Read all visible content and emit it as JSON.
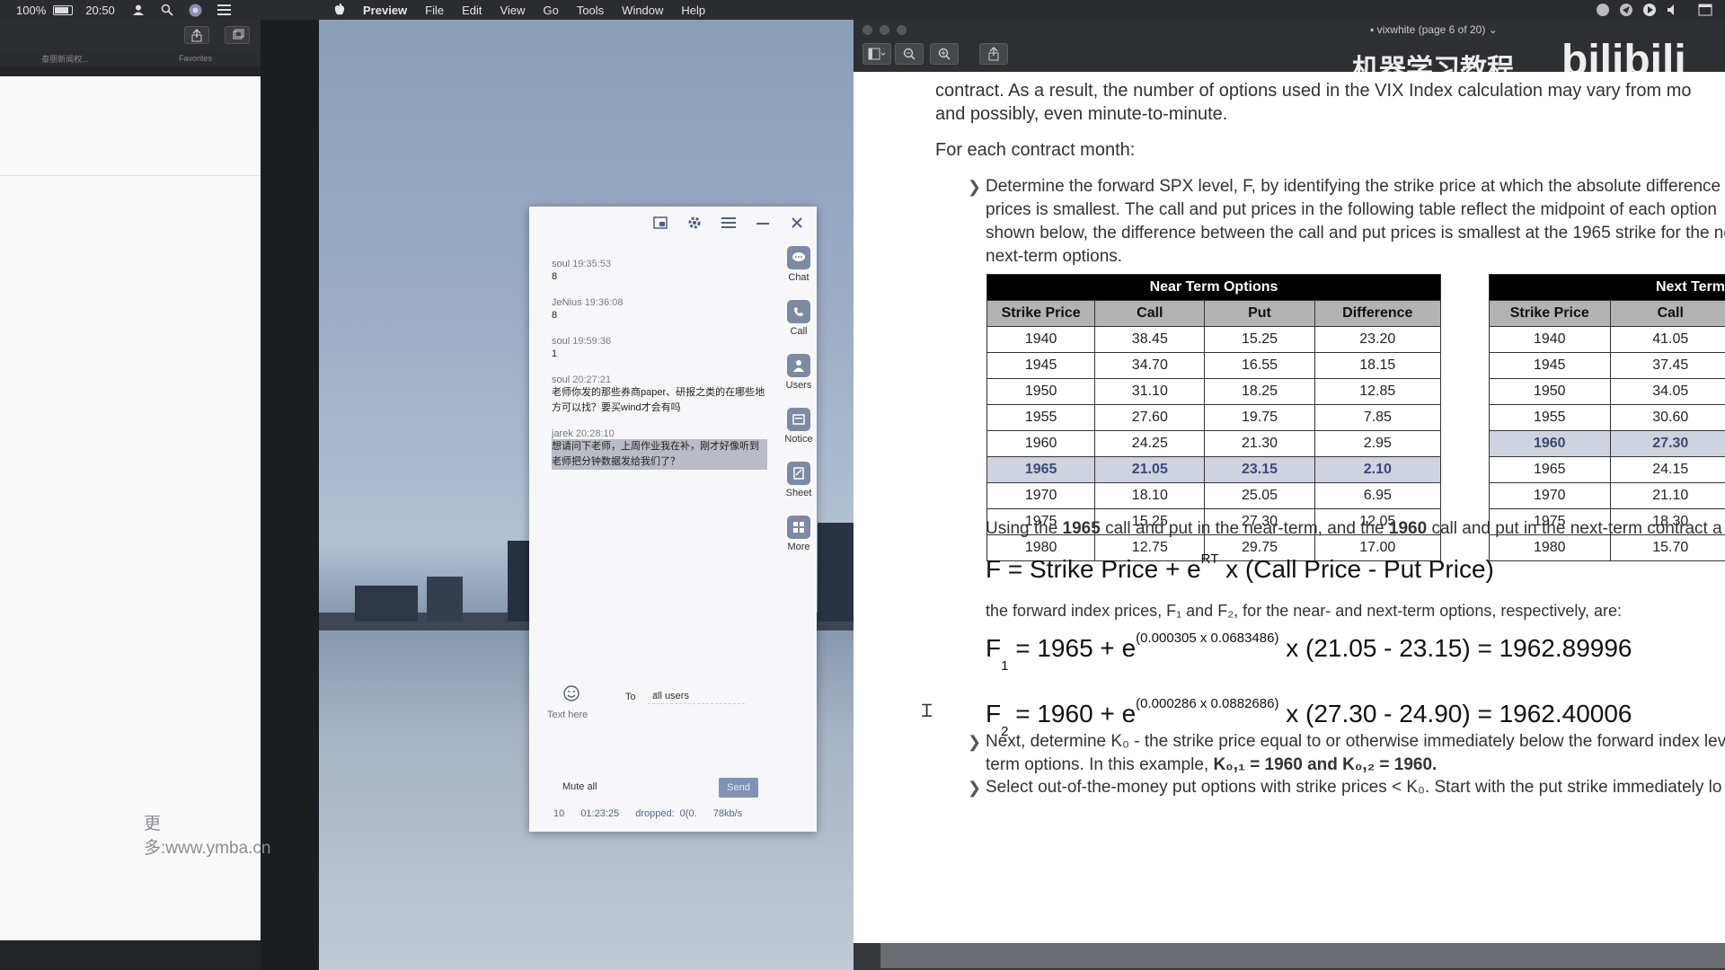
{
  "menubar": {
    "battery_percent": "100%",
    "clock": "20:50",
    "apple": "",
    "app_name": "Preview",
    "menus": [
      "File",
      "Edit",
      "View",
      "Go",
      "Tools",
      "Window",
      "Help"
    ]
  },
  "left_panel": {
    "tab_left": "泰朋新闻权...",
    "tab_right": "Favorites",
    "watermark": "更多:www.ymba.cn"
  },
  "chat": {
    "messages": [
      {
        "user": "soul",
        "time": "19:35:53",
        "text": "8",
        "selected": false
      },
      {
        "user": "JeNius",
        "time": "19:36:08",
        "text": "8",
        "selected": false
      },
      {
        "user": "soul",
        "time": "19:59:36",
        "text": "1",
        "selected": false
      },
      {
        "user": "soul",
        "time": "20:27:21",
        "text": "老师你发的那些券商paper、研报之类的在哪些地方可以找？要买wind才会有吗",
        "selected": false
      },
      {
        "user": "jarek",
        "time": "20:28:10",
        "text": "想请问下老师，上周作业我在补，刚才好像听到老师把分钟数据发给我们了？",
        "selected": true
      }
    ],
    "rail": [
      {
        "label": "Chat",
        "icon": "chat-icon"
      },
      {
        "label": "Call",
        "icon": "call-icon"
      },
      {
        "label": "Users",
        "icon": "users-icon"
      },
      {
        "label": "Notice",
        "icon": "notice-icon"
      },
      {
        "label": "Sheet",
        "icon": "sheet-icon"
      },
      {
        "label": "More",
        "icon": "more-icon"
      }
    ],
    "text_placeholder": "Text here",
    "to_label": "To",
    "to_value": "all users",
    "mute_label": "Mute all",
    "send_label": "Send",
    "status": {
      "count": "10",
      "elapsed": "01:23:25",
      "dropped": "dropped: 0(0.",
      "rate": "78kb/s"
    }
  },
  "preview": {
    "doc_title": "vixwhite (page 6 of 20)",
    "watermark_cn": "机器学习教程",
    "watermark_bili": "bilibili",
    "intro_line1": "contract.  As a result, the number of options used in the VIX Index calculation may vary from mo",
    "intro_line2": "and possibly, even minute-to-minute.",
    "heading": "For each contract month:",
    "bullet1_lines": [
      "Determine the forward SPX level, F, by identifying the strike price at which the absolute difference b",
      "prices is smallest.  The call and put prices in the following table reflect the midpoint of each option",
      "shown below, the difference between the call and put prices is smallest at the 1965 strike for the ne",
      "next-term options."
    ],
    "near_table": {
      "title": "Near Term Options",
      "columns": [
        "Strike Price",
        "Call",
        "Put",
        "Difference"
      ],
      "rows": [
        [
          "1940",
          "38.45",
          "15.25",
          "23.20"
        ],
        [
          "1945",
          "34.70",
          "16.55",
          "18.15"
        ],
        [
          "1950",
          "31.10",
          "18.25",
          "12.85"
        ],
        [
          "1955",
          "27.60",
          "19.75",
          "7.85"
        ],
        [
          "1960",
          "24.25",
          "21.30",
          "2.95"
        ],
        [
          "1965",
          "21.05",
          "23.15",
          "2.10"
        ],
        [
          "1970",
          "18.10",
          "25.05",
          "6.95"
        ],
        [
          "1975",
          "15.25",
          "27.30",
          "12.05"
        ],
        [
          "1980",
          "12.75",
          "29.75",
          "17.00"
        ]
      ],
      "highlight_row": 5
    },
    "next_table": {
      "title": "Next Term",
      "columns": [
        "Strike Price",
        "Call"
      ],
      "rows": [
        [
          "1940",
          "41.05"
        ],
        [
          "1945",
          "37.45"
        ],
        [
          "1950",
          "34.05"
        ],
        [
          "1955",
          "30.60"
        ],
        [
          "1960",
          "27.30"
        ],
        [
          "1965",
          "24.15"
        ],
        [
          "1970",
          "21.10"
        ],
        [
          "1975",
          "18.30"
        ],
        [
          "1980",
          "15.70"
        ]
      ],
      "highlight_row": 4
    },
    "using_line": {
      "pre": "Using the ",
      "strike1": "1965",
      "mid": " call and put in the near-term, and the ",
      "strike2": "1960",
      "post": " call and put in the next-term contract a"
    },
    "formula_main": {
      "lhs": "F = Strike Price + e",
      "sup": "RT",
      "rhs": " x (Call Price - Put Price)"
    },
    "forward_line": "the forward index prices, F₁ and F₂, for the near- and next-term options, respectively, are:",
    "f1": {
      "lhs": "F",
      "sub": "1",
      "mid": " = 1965 + e",
      "sup": "(0.000305 x 0.0683486)",
      "rhs": " x (21.05 - 23.15) = 1962.89996"
    },
    "f2": {
      "lhs": "F",
      "sub": "2",
      "mid": " = 1960 + e",
      "sup": "(0.000286 x 0.0882686)",
      "rhs": " x (27.30 - 24.90) = 1962.40006"
    },
    "bullet2_line1": "Next, determine K₀ - the strike price equal to or otherwise immediately below the forward index lev",
    "bullet2_line2_pre": "term options.  In this example, ",
    "bullet2_line2_bold": "K₀,₁ = 1960 and K₀,₂ = 1960.",
    "bullet3_line": "Select out-of-the-money put options with strike prices < K₀.  Start with the put strike immediately lo"
  }
}
